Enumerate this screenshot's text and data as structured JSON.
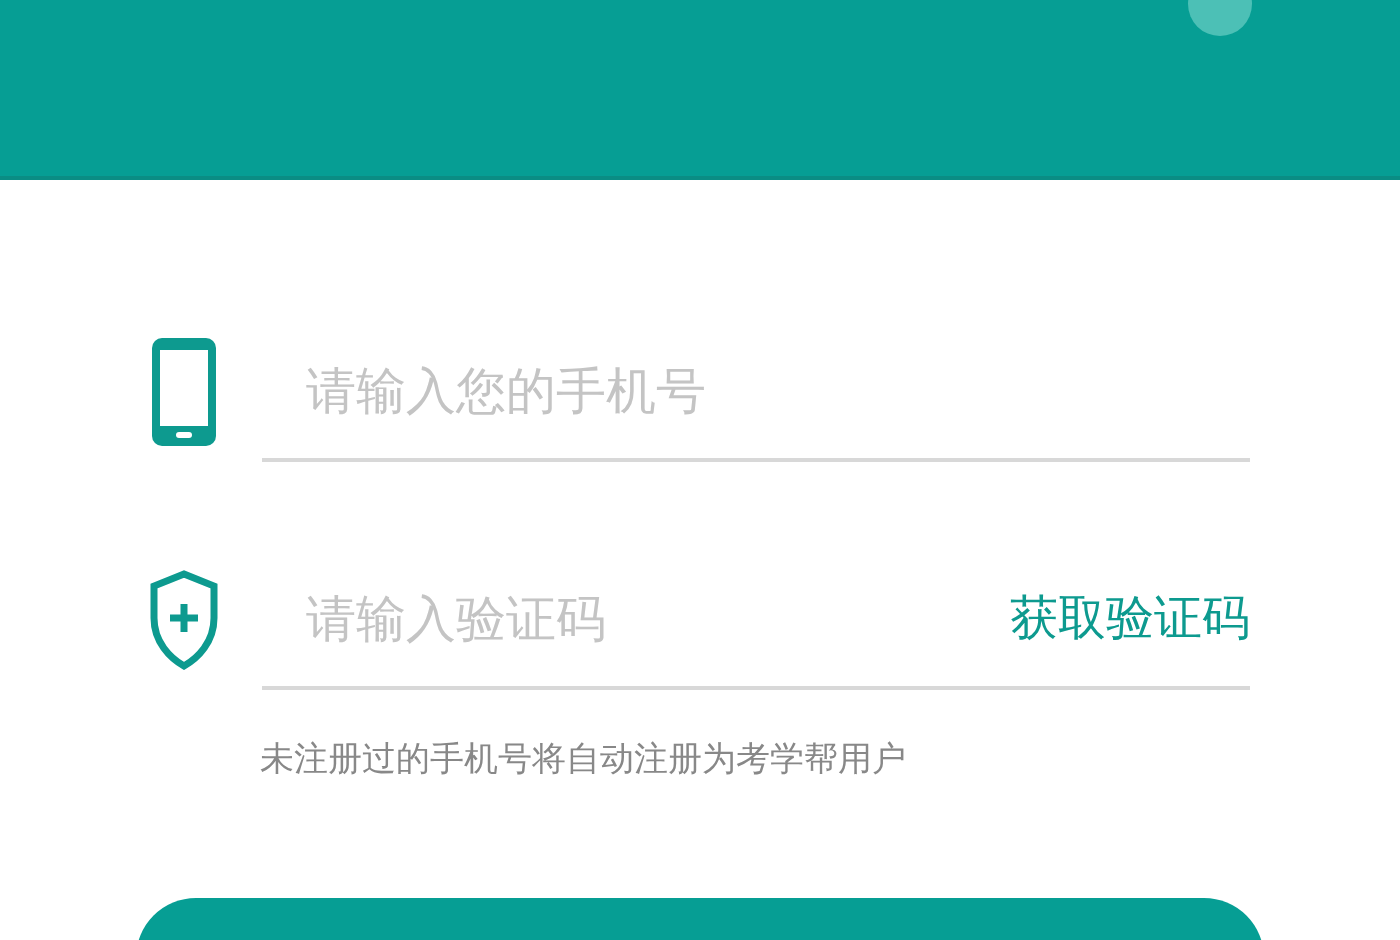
{
  "phone_field": {
    "placeholder": "请输入您的手机号"
  },
  "code_field": {
    "placeholder": "请输入验证码",
    "action": "获取验证码"
  },
  "hint": "未注册过的手机号将自动注册为考学帮用户"
}
